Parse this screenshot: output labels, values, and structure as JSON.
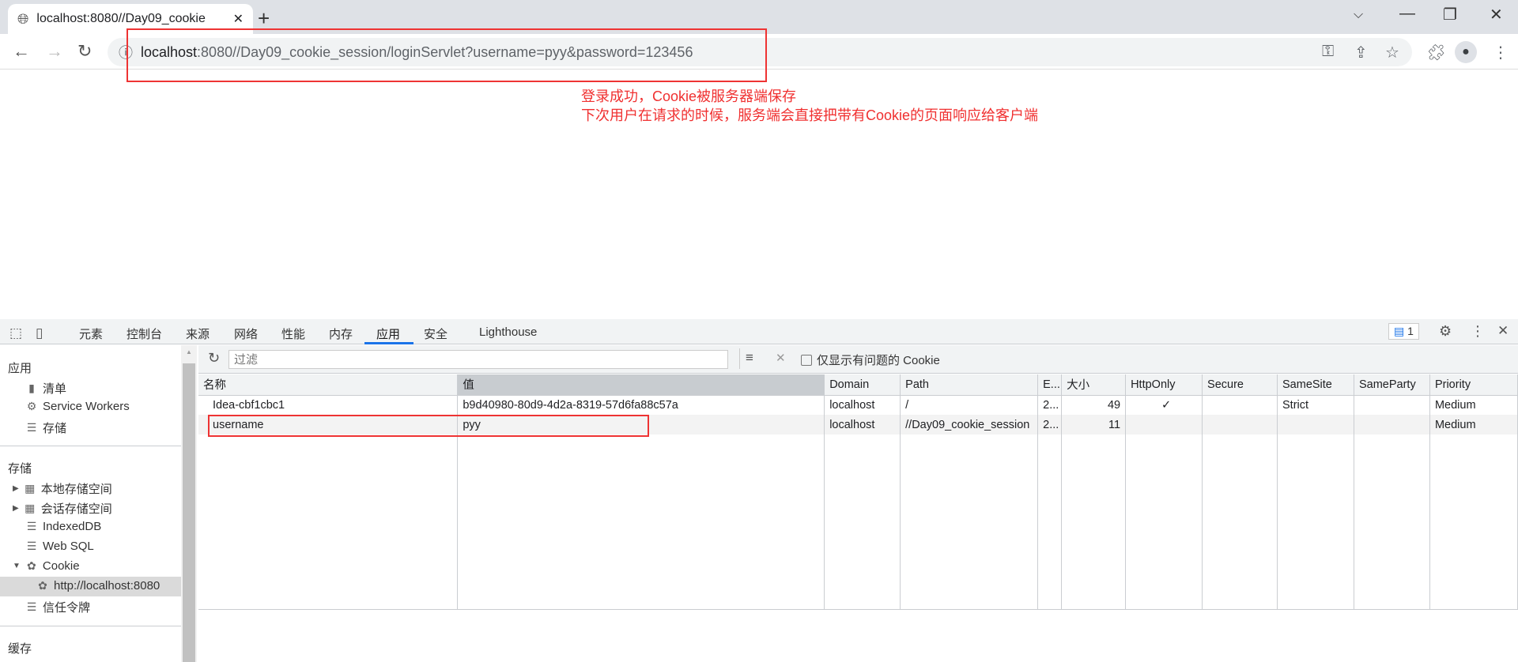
{
  "browser": {
    "tab_title": "localhost:8080//Day09_cookie_session/loginServlet?username=pyy&password=123456",
    "tab_title_visible": "localhost:8080//Day09_cookie",
    "url_host": "localhost",
    "url_rest": ":8080//Day09_cookie_session/loginServlet?username=pyy&password=123456"
  },
  "annotation": {
    "line1": "登录成功，Cookie被服务器端保存",
    "line2": "下次用户在请求的时候，服务端会直接把带有Cookie的页面响应给客户端",
    "color": "#f03030"
  },
  "devtools": {
    "tabs": [
      "元素",
      "控制台",
      "来源",
      "网络",
      "性能",
      "内存",
      "应用",
      "安全",
      "Lighthouse"
    ],
    "active_tab": "应用",
    "issues_count": "1",
    "sidebar": {
      "section_app": "应用",
      "app_items": [
        "清单",
        "Service Workers",
        "存储"
      ],
      "section_storage": "存储",
      "storage_items": [
        "本地存储空间",
        "会话存储空间",
        "IndexedDB",
        "Web SQL",
        "Cookie"
      ],
      "cookie_origin": "http://localhost:8080",
      "trust_tokens": "信任令牌",
      "section_cache": "缓存"
    },
    "filter_placeholder": "过滤",
    "only_issues_label": "仅显示有问题的 Cookie",
    "columns": [
      "名称",
      "值",
      "Domain",
      "Path",
      "E...",
      "大小",
      "HttpOnly",
      "Secure",
      "SameSite",
      "SameParty",
      "Priority"
    ],
    "rows": [
      [
        "Idea-cbf1cbc1",
        "b9d40980-80d9-4d2a-8319-57d6fa88c57a",
        "localhost",
        "/",
        "2...",
        "49",
        "✓",
        "",
        "Strict",
        "",
        "Medium"
      ],
      [
        "username",
        "pyy",
        "localhost",
        "//Day09_cookie_session",
        "2...",
        "11",
        "",
        "",
        "",
        "",
        "Medium"
      ]
    ],
    "accent": "#1a73e8"
  }
}
